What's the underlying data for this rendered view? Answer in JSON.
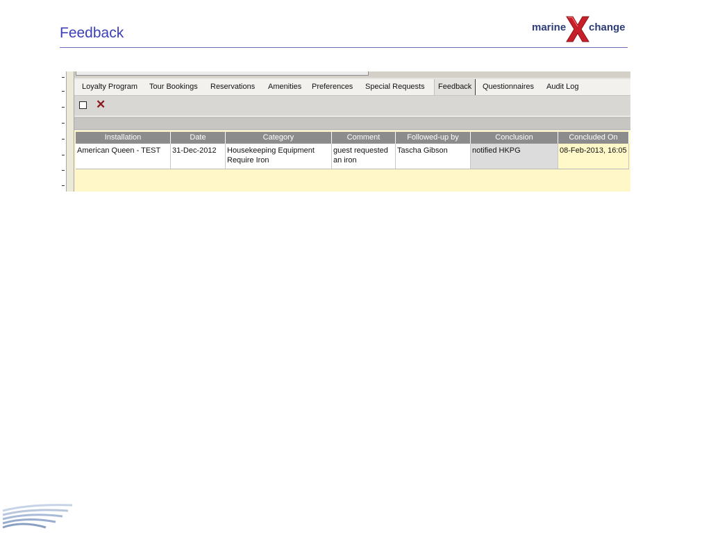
{
  "slide": {
    "title": "Feedback"
  },
  "logo": {
    "word_left": "marine",
    "letter": "X",
    "word_right": "change",
    "colors": {
      "text": "#2d3c78",
      "x_fill": "#c8202a"
    }
  },
  "tabs": [
    {
      "label": "Loyalty Program",
      "active": false
    },
    {
      "label": "Tour Bookings",
      "active": false
    },
    {
      "label": "Reservations",
      "active": false
    },
    {
      "label": "Amenities",
      "active": false
    },
    {
      "label": "Preferences",
      "active": false
    },
    {
      "label": "Special Requests",
      "active": false
    },
    {
      "label": "Feedback",
      "active": true
    },
    {
      "label": "Questionnaires",
      "active": false
    },
    {
      "label": "Audit Log",
      "active": false
    }
  ],
  "toolbar": {
    "new_icon": "checkbox-new-icon",
    "delete_icon": "delete-x-icon",
    "delete_glyph": "✕"
  },
  "table": {
    "columns": [
      "Installation",
      "Date",
      "Category",
      "Comment",
      "Followed-up by",
      "Conclusion",
      "Concluded On"
    ],
    "rows": [
      {
        "installation": "American Queen - TEST",
        "date": "31-Dec-2012",
        "category": "Housekeeping Equipment Require Iron",
        "comment": "guest requested an iron",
        "followed_up_by": "Tascha Gibson",
        "conclusion": "notified HKPG",
        "concluded_on": "08-Feb-2013, 16:05"
      }
    ]
  },
  "colors": {
    "title": "#3b3fb8",
    "header_bg": "#8c8c8c",
    "grid_bg": "#fff7c8",
    "delete_icon": "#8b1a1a"
  }
}
